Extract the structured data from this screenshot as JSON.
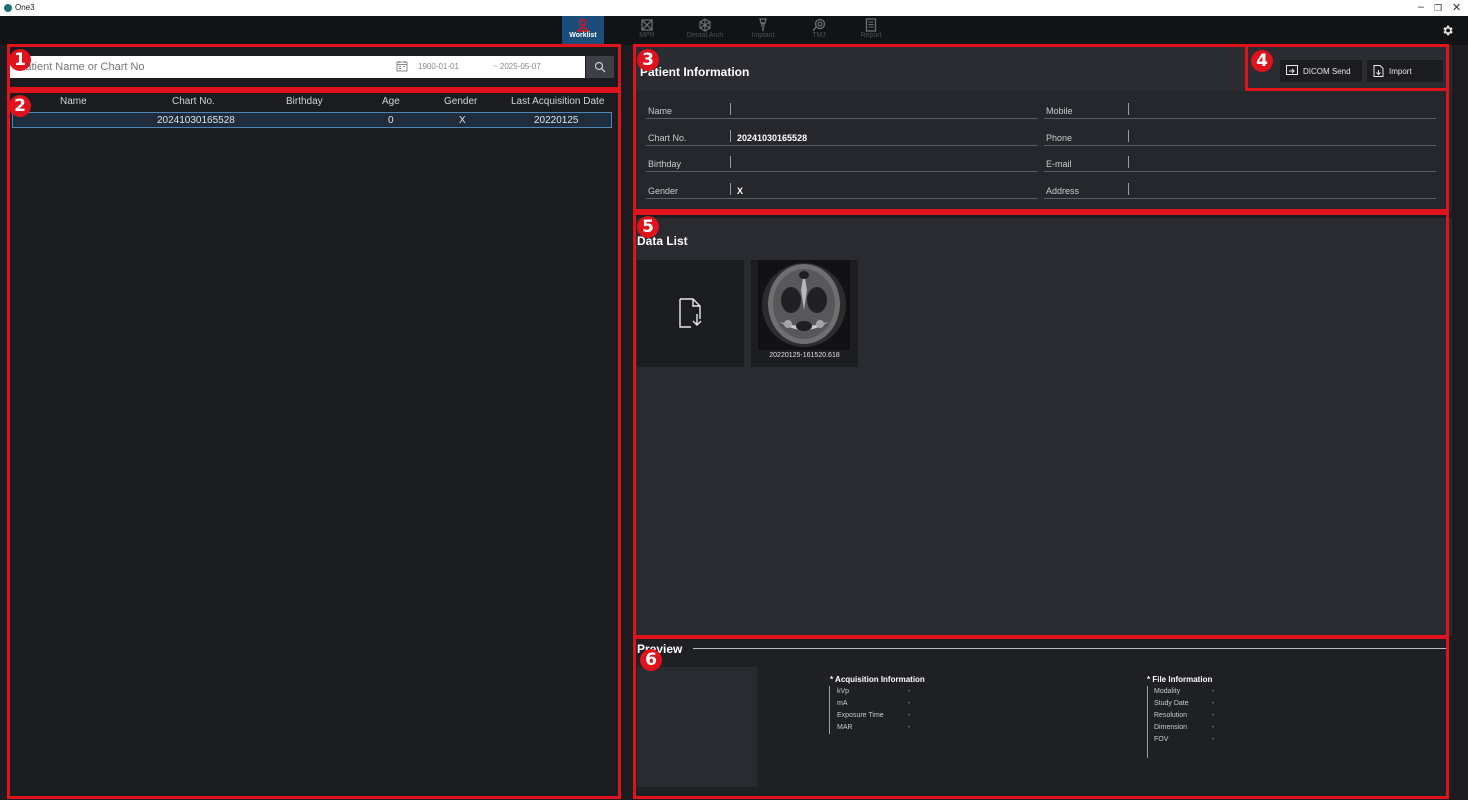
{
  "window": {
    "title": "One3",
    "minimize": "–",
    "restore": "❐",
    "close": "✕"
  },
  "toolbar": {
    "items": [
      {
        "label": "Worklist",
        "icon": "worklist-icon",
        "active": true
      },
      {
        "label": "MPR",
        "icon": "mpr-icon",
        "active": false
      },
      {
        "label": "Dental Arch",
        "icon": "dental-arch-icon",
        "active": false
      },
      {
        "label": "Implant",
        "icon": "implant-icon",
        "active": false
      },
      {
        "label": "TMJ",
        "icon": "tmj-icon",
        "active": false
      },
      {
        "label": "Report",
        "icon": "report-icon",
        "active": false
      }
    ],
    "settings_icon": "gear-icon"
  },
  "search": {
    "placeholder": "Patient Name or Chart No",
    "date_from": "1900-01-01",
    "date_to": "~  2025-05-07"
  },
  "worklist": {
    "columns": [
      "Name",
      "Chart No.",
      "Birthday",
      "Age",
      "Gender",
      "Last Acquisition Date"
    ],
    "rows": [
      {
        "name": "",
        "chart_no": "20241030165528",
        "birthday": "",
        "age": "0",
        "gender": "X",
        "last_acquisition": "20220125"
      }
    ]
  },
  "patient_info": {
    "title": "Patient Information",
    "fields_left": [
      {
        "label": "Name",
        "value": ""
      },
      {
        "label": "Chart No.",
        "value": "20241030165528"
      },
      {
        "label": "Birthday",
        "value": ""
      },
      {
        "label": "Gender",
        "value": "X"
      }
    ],
    "fields_right": [
      {
        "label": "Mobile",
        "value": ""
      },
      {
        "label": "Phone",
        "value": ""
      },
      {
        "label": "E-mail",
        "value": ""
      },
      {
        "label": "Address",
        "value": ""
      }
    ]
  },
  "actions": {
    "dicom_send": "DICOM Send",
    "import": "Import"
  },
  "data_list": {
    "title": "Data List",
    "items": [
      {
        "caption": "20220125-161520.618"
      }
    ]
  },
  "preview": {
    "title": "Preview",
    "acquisition": {
      "title": "* Acquisition Information",
      "rows": [
        {
          "label": "kVp",
          "value": "-"
        },
        {
          "label": "mA",
          "value": "-"
        },
        {
          "label": "Exposure Time",
          "value": "-"
        },
        {
          "label": "MAR",
          "value": "-"
        }
      ]
    },
    "file": {
      "title": "* File Information",
      "rows": [
        {
          "label": "Modality",
          "value": "-"
        },
        {
          "label": "Study Date",
          "value": "-"
        },
        {
          "label": "Resolution",
          "value": "-"
        },
        {
          "label": "Dimension",
          "value": "-"
        },
        {
          "label": "FOV",
          "value": "-"
        }
      ]
    }
  },
  "annotations": [
    "1",
    "2",
    "3",
    "4",
    "5",
    "6"
  ],
  "colors": {
    "accent_red": "#e0121b",
    "active_tab": "#1a4d7a",
    "selection": "#4d86b8"
  }
}
